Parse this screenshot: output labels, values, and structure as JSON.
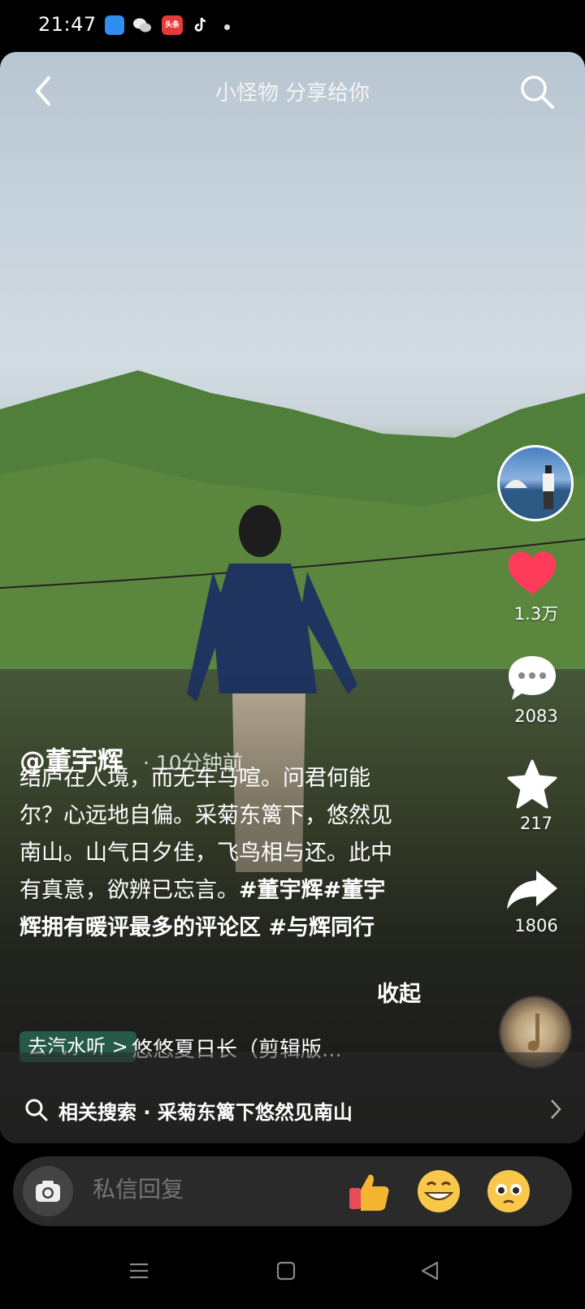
{
  "status_bar": {
    "time": "21:47",
    "notification_icons": [
      "blue-app-icon",
      "wechat-icon",
      "toutiao-icon",
      "tiktok-icon",
      "more-dot-icon"
    ],
    "news_icon_label": "头条"
  },
  "header": {
    "title": "小怪物 分享给你",
    "back_icon": "back-icon",
    "search_icon": "search-icon"
  },
  "actions": {
    "likes": "1.3万",
    "comments": "2083",
    "favorites": "217",
    "shares": "1806"
  },
  "post": {
    "author": "@董宇辉",
    "time_ago": "· 10分钟前",
    "lines": [
      "结庐在人境，而无车马喧。问君何能",
      "尔？心远地自偏。采菊东篱下，悠然见",
      "南山。山气日夕佳，飞鸟相与还。此中",
      "有真意，欲辨已忘言。"
    ],
    "hashtag_line4": "#董宇辉#董宇",
    "hashtag_line5": "辉拥有暖评最多的评论区 #与辉同行",
    "collapse_label": "收起"
  },
  "music": {
    "tag": "去汽水听 >",
    "name": "悠悠夏日长（剪辑版..."
  },
  "related": {
    "text": "相关搜索 · 采菊东篱下悠然见南山"
  },
  "reply": {
    "placeholder": "私信回复",
    "emojis": [
      "thumbs-up-icon",
      "grin-icon",
      "pleading-face-icon"
    ]
  },
  "colors": {
    "like": "#ff3b5c",
    "music_tag_bg": "#286450"
  }
}
